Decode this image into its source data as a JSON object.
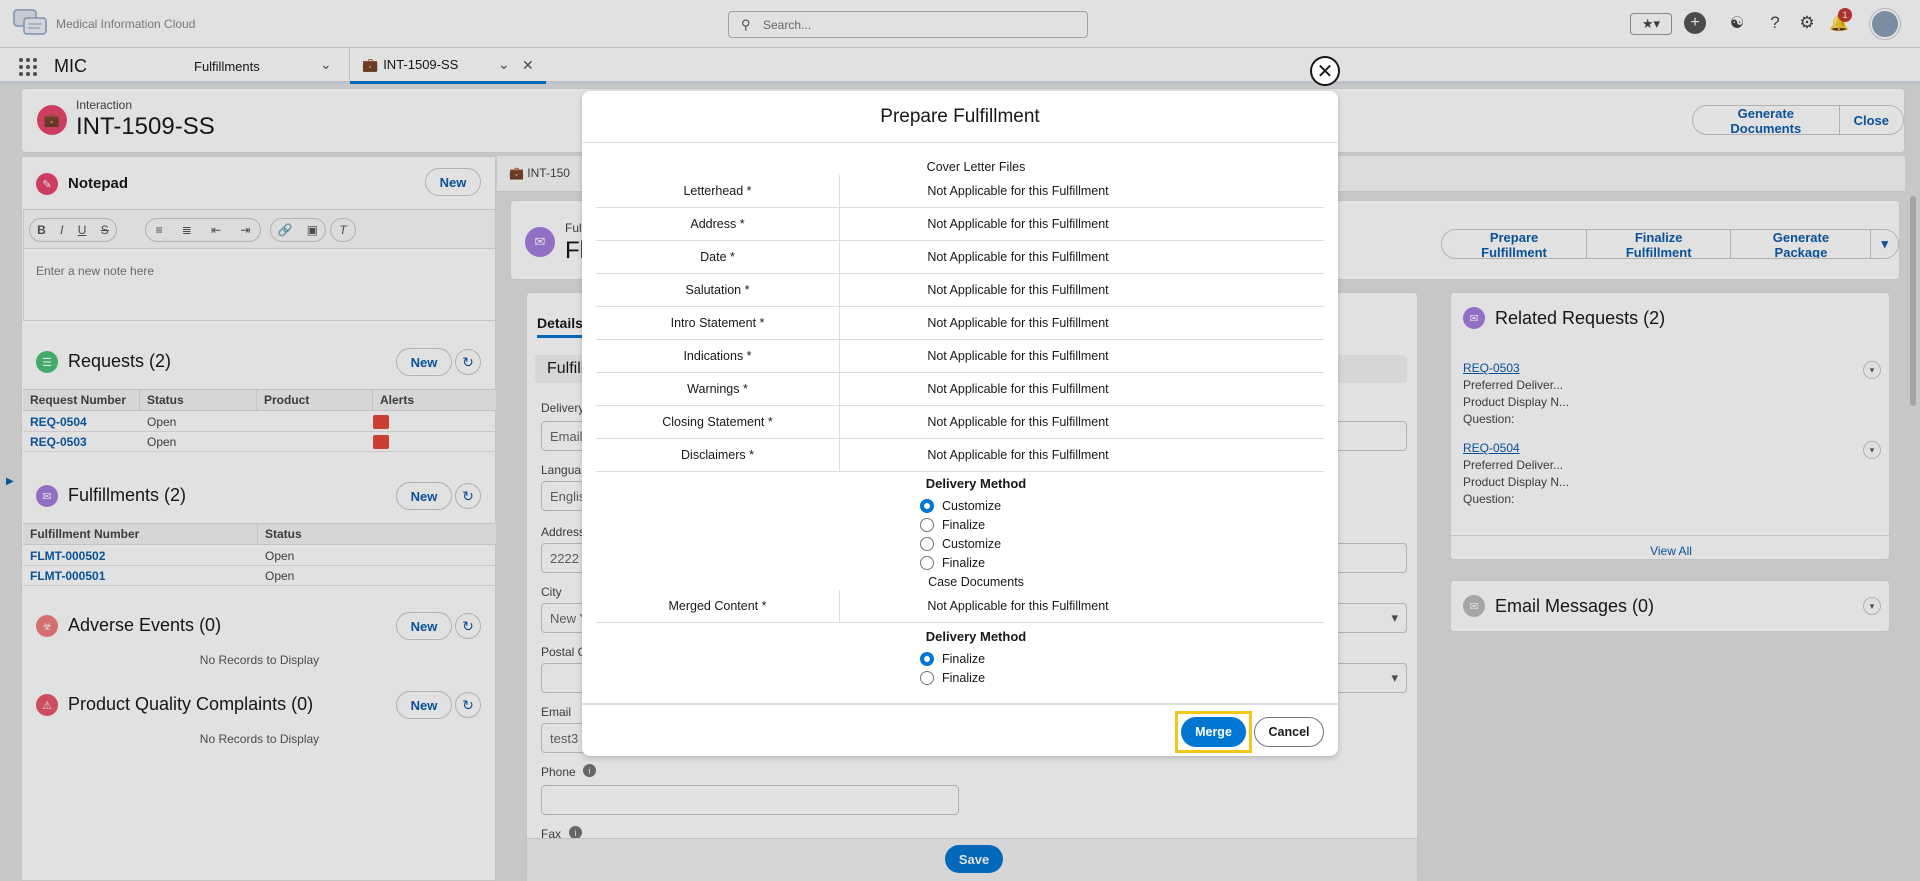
{
  "app": {
    "name": "Medical Information Cloud",
    "short": "MIC"
  },
  "search": {
    "placeholder": "Search..."
  },
  "header": {
    "notification_count": "1"
  },
  "nav": {
    "tab1": "Fulfillments",
    "tab2": "INT-1509-SS"
  },
  "record": {
    "type": "Interaction",
    "name": "INT-1509-SS",
    "generate_docs": "Generate Documents",
    "close": "Close"
  },
  "notepad": {
    "title": "Notepad",
    "new": "New",
    "placeholder": "Enter a new note here"
  },
  "requests": {
    "title": "Requests (2)",
    "new": "New",
    "columns": [
      "Request Number",
      "Status",
      "Product",
      "Alerts"
    ],
    "rows": [
      {
        "number": "REQ-0504",
        "status": "Open"
      },
      {
        "number": "REQ-0503",
        "status": "Open"
      }
    ]
  },
  "fulfillments": {
    "title": "Fulfillments (2)",
    "new": "New",
    "columns": [
      "Fulfillment Number",
      "Status"
    ],
    "rows": [
      {
        "number": "FLMT-000502",
        "status": "Open"
      },
      {
        "number": "FLMT-000501",
        "status": "Open"
      }
    ]
  },
  "adverse": {
    "title": "Adverse Events (0)",
    "new": "New",
    "empty": "No Records to Display"
  },
  "pqc": {
    "title": "Product Quality Complaints (0)",
    "new": "New",
    "empty": "No Records to Display"
  },
  "subtab": {
    "label": "INT-150"
  },
  "fulfillment_record": {
    "type": "Ful",
    "name": "Fl",
    "prepare": "Prepare Fulfillment",
    "finalize": "Finalize Fulfillment",
    "package": "Generate Package"
  },
  "details": {
    "tab": "Details",
    "section": "Fulfill",
    "fields": [
      {
        "label": "Delivery",
        "value": "Email"
      },
      {
        "label": "Langua",
        "value": "English"
      },
      {
        "label": "Address",
        "value": "2222"
      },
      {
        "label": "City",
        "value": "New Y"
      },
      {
        "label": "Postal C",
        "value": ""
      },
      {
        "label": "Email",
        "value": "test3"
      },
      {
        "label": "Phone",
        "value": ""
      },
      {
        "label": "Fax",
        "value": ""
      }
    ],
    "save": "Save"
  },
  "related": {
    "title": "Related Requests (2)",
    "items": [
      {
        "number": "REQ-0503",
        "l1": "Preferred Deliver...",
        "l2": "Product Display N...",
        "l3": "Question:"
      },
      {
        "number": "REQ-0504",
        "l1": "Preferred Deliver...",
        "l2": "Product Display N...",
        "l3": "Question:"
      }
    ],
    "view_all": "View All"
  },
  "email_messages": {
    "title": "Email Messages (0)"
  },
  "modal": {
    "title": "Prepare Fulfillment",
    "cover_heading": "Cover Letter Files",
    "rows": [
      {
        "label": "Letterhead *",
        "value": "Not Applicable for this Fulfillment"
      },
      {
        "label": "Address *",
        "value": "Not Applicable for this Fulfillment"
      },
      {
        "label": "Date *",
        "value": "Not Applicable for this Fulfillment"
      },
      {
        "label": "Salutation *",
        "value": "Not Applicable for this Fulfillment"
      },
      {
        "label": "Intro Statement *",
        "value": "Not Applicable for this Fulfillment"
      },
      {
        "label": "Indications *",
        "value": "Not Applicable for this Fulfillment"
      },
      {
        "label": "Warnings *",
        "value": "Not Applicable for this Fulfillment"
      },
      {
        "label": "Closing Statement *",
        "value": "Not Applicable for this Fulfillment"
      },
      {
        "label": "Disclaimers *",
        "value": "Not Applicable for this Fulfillment"
      }
    ],
    "delivery1": {
      "heading": "Delivery Method",
      "options": [
        "Customize",
        "Finalize",
        "Customize",
        "Finalize"
      ],
      "selected": 0
    },
    "case_heading": "Case Documents",
    "merged": {
      "label": "Merged Content *",
      "value": "Not Applicable for this Fulfillment"
    },
    "delivery2": {
      "heading": "Delivery Method",
      "options": [
        "Finalize",
        "Finalize"
      ],
      "selected": 0
    },
    "merge": "Merge",
    "cancel": "Cancel"
  }
}
